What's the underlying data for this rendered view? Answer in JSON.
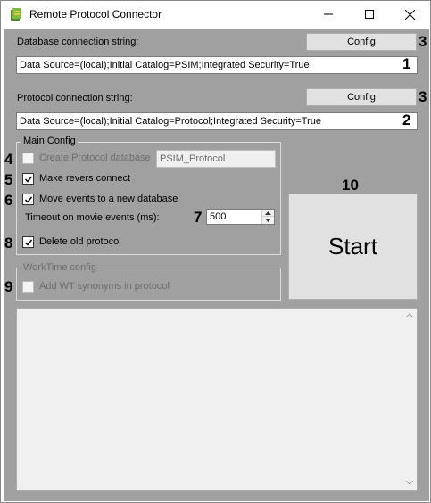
{
  "window": {
    "title": "Remote Protocol Connector",
    "controls": {
      "minimize": "—",
      "maximize": "☐",
      "close": "✕"
    }
  },
  "db": {
    "label": "Database connection string:",
    "config_label": "Config",
    "value": "Data Source=(local);Initial Catalog=PSIM;Integrated Security=True"
  },
  "protocol": {
    "label": "Protocol connection string:",
    "config_label": "Config",
    "value": "Data Source=(local);Initial Catalog=Protocol;Integrated Security=True"
  },
  "main_config": {
    "title": "Main Config",
    "create_db_label": "Create Protocol database",
    "create_db_checked": false,
    "create_db_name": "PSIM_Protocol",
    "revers_label": "Make revers connect",
    "revers_checked": true,
    "move_events_label": "Move events to a new database",
    "move_events_checked": true,
    "timeout_label": "Timeout on movie events (ms):",
    "timeout_value": "500",
    "delete_old_label": "Delete old protocol",
    "delete_old_checked": true
  },
  "worktime": {
    "title": "WorkTime config",
    "wt_label": "Add WT synonyms in protocol",
    "wt_checked": false
  },
  "start_label": "Start",
  "annotations": {
    "n1": "1",
    "n2": "2",
    "n3a": "3",
    "n3b": "3",
    "n4": "4",
    "n5": "5",
    "n6": "6",
    "n7": "7",
    "n8": "8",
    "n9": "9",
    "n10": "10"
  }
}
